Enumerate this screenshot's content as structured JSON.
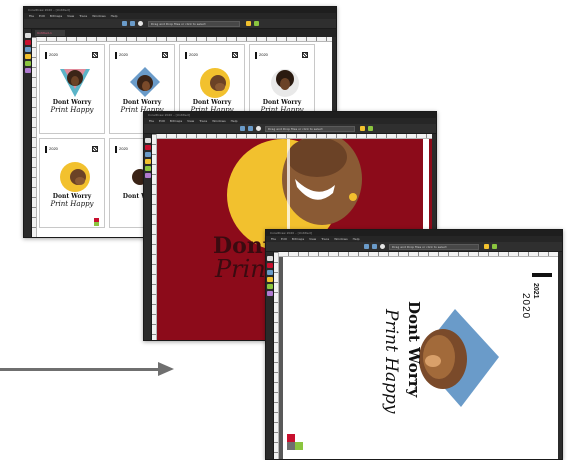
{
  "app": {
    "title": "CorelDraw 2020 – [Untitled]",
    "menu": [
      "File",
      "Edit",
      "Bitmaps",
      "View",
      "Trace",
      "Windows",
      "Help"
    ],
    "url_field": "Drag and Drop files or click to select"
  },
  "window_labels": {
    "tab_label": "Untitled-1"
  },
  "design": {
    "year": "2020",
    "year_alt": "2021",
    "line1": "Dont Worry",
    "line2": "Print Happy"
  },
  "colors": {
    "brand_red": "#c8102e",
    "brand_green": "#8bc53f",
    "maroon": "#8c0b1a",
    "sun_yellow": "#f2c12e",
    "sky_blue": "#6a9bc9",
    "ui_dark": "#2b2b2b"
  },
  "icons": [
    "undo-icon",
    "redo-icon",
    "color-swatch-icon",
    "pen-tool-icon",
    "shape-tool-icon",
    "crop-tool-icon",
    "zoom-icon",
    "arrow-right-icon"
  ]
}
